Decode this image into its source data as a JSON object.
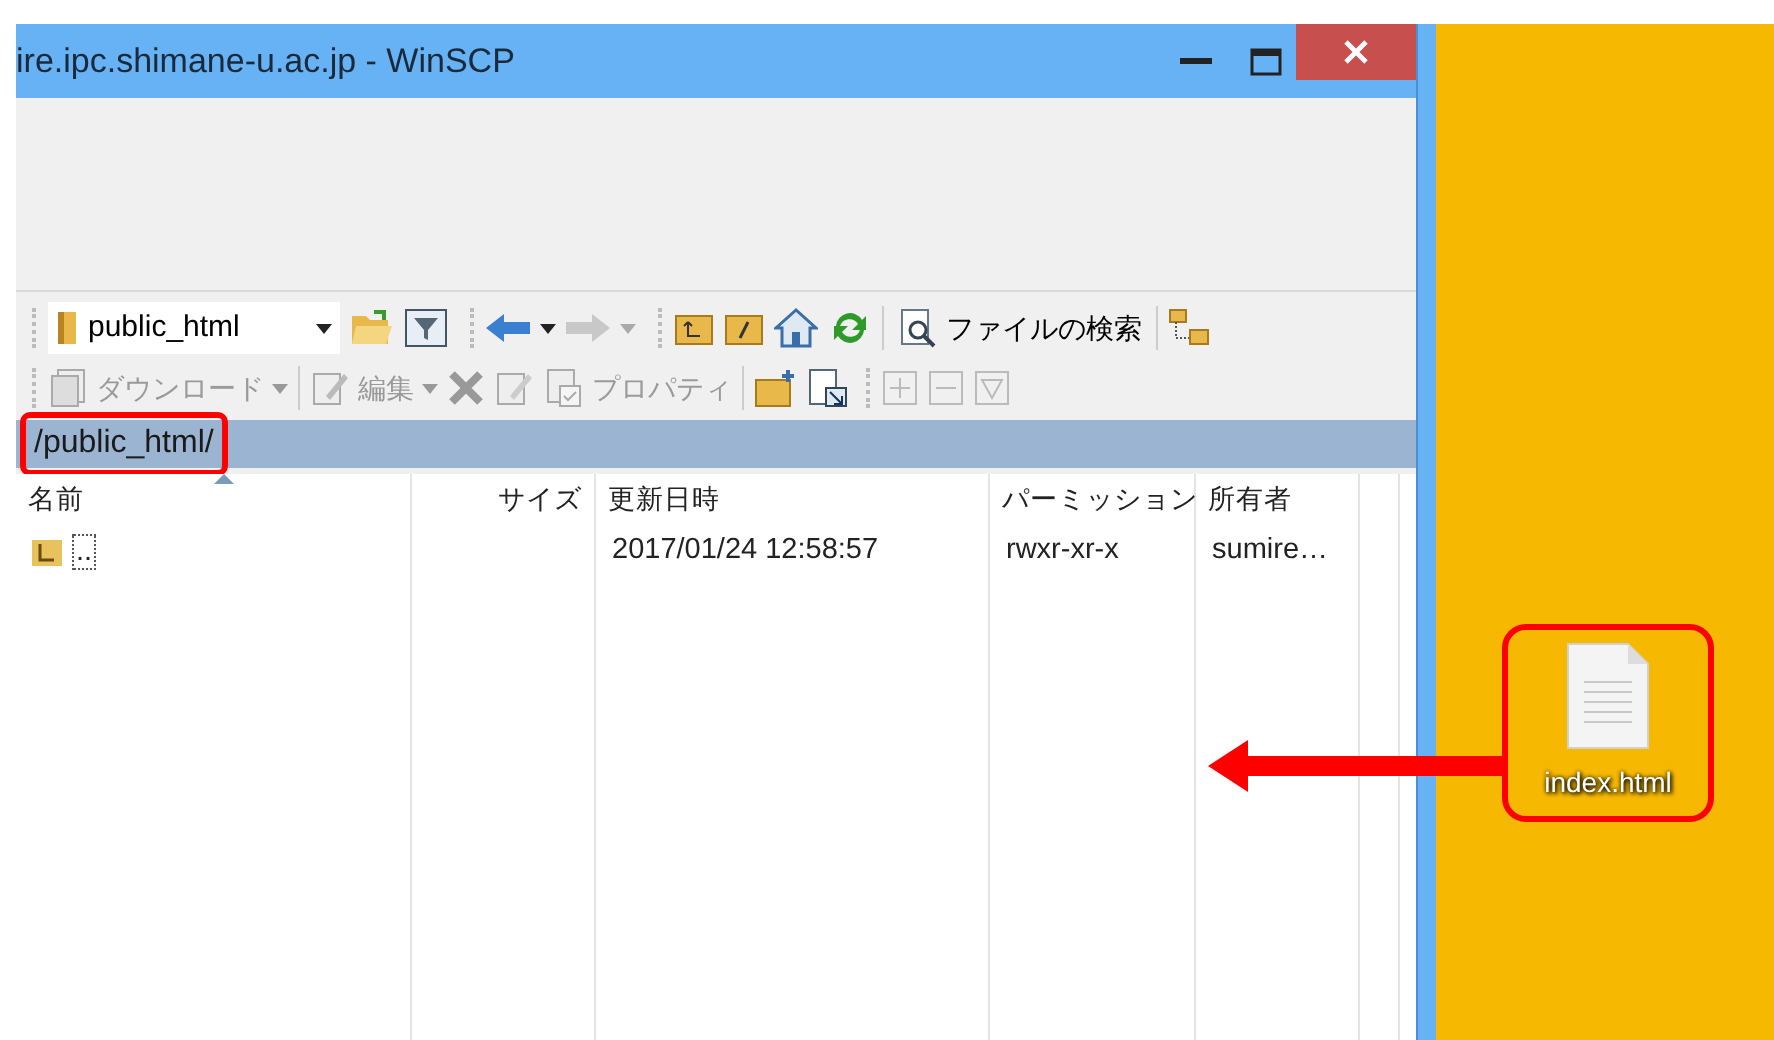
{
  "window": {
    "title": "ire.ipc.shimane-u.ac.jp - WinSCP"
  },
  "toolbar_1": {
    "location": "public_html",
    "find_button": "ファイルの検索",
    "forward_disabled": true
  },
  "toolbar_2": {
    "disabled": true,
    "download": "ダウンロード",
    "edit": "編集",
    "properties": "プロパティ"
  },
  "path": {
    "text": "/public_html/",
    "highlighted": true
  },
  "columns": [
    {
      "label": "名前",
      "sorted": true
    },
    {
      "label": "サイズ",
      "sorted": false
    },
    {
      "label": "更新日時",
      "sorted": false
    },
    {
      "label": "パーミッション",
      "sorted": false
    },
    {
      "label": "所有者",
      "sorted": false
    }
  ],
  "rows": [
    {
      "name": "..",
      "modified": "2017/01/24 12:58:57",
      "permissions": "rwxr-xr-x",
      "owner": "sumire…",
      "selected": false
    }
  ],
  "desktop": {
    "icons": [
      {
        "label": "index.html",
        "highlighted": true
      }
    ]
  },
  "annotation": {
    "arrow": true
  }
}
